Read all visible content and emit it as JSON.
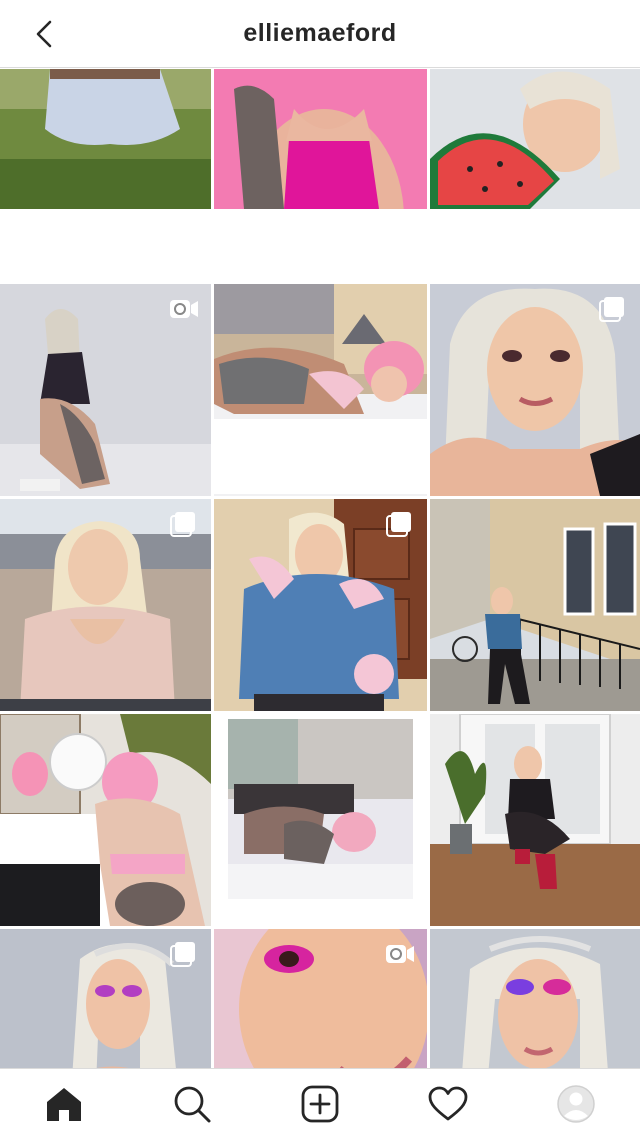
{
  "header": {
    "title": "elliemaeford",
    "back_icon": "chevron-left-icon"
  },
  "grid": {
    "posts": [
      {
        "scene": "grass-field",
        "type": "photo"
      },
      {
        "scene": "pink-wall-tattoo",
        "type": "photo"
      },
      {
        "scene": "watermelon-fan",
        "type": "photo"
      },
      {
        "scene": "studio-pose",
        "type": "video"
      },
      {
        "scene": "bed-lounge",
        "type": "photo"
      },
      {
        "scene": "blonde-portrait",
        "type": "carousel"
      },
      {
        "scene": "outdoor-square",
        "type": "carousel"
      },
      {
        "scene": "denim-jacket",
        "type": "carousel"
      },
      {
        "scene": "street-railing",
        "type": "photo"
      },
      {
        "scene": "mirror-pose",
        "type": "photo"
      },
      {
        "scene": "bed-polaroid",
        "type": "photo"
      },
      {
        "scene": "doorway-crouch",
        "type": "photo"
      },
      {
        "scene": "headband-portrait",
        "type": "carousel"
      },
      {
        "scene": "closeup-makeup",
        "type": "video"
      },
      {
        "scene": "profile-makeup",
        "type": "photo"
      }
    ]
  },
  "bottom_nav": {
    "items": [
      "home-icon",
      "search-icon",
      "add-post-icon",
      "activity-heart-icon",
      "profile-avatar-icon"
    ],
    "active": "home-icon"
  },
  "colors": {
    "text": "#262626",
    "border": "#dbdbdb",
    "pink_bg": "#f36fb0",
    "magenta": "#e0159a"
  }
}
